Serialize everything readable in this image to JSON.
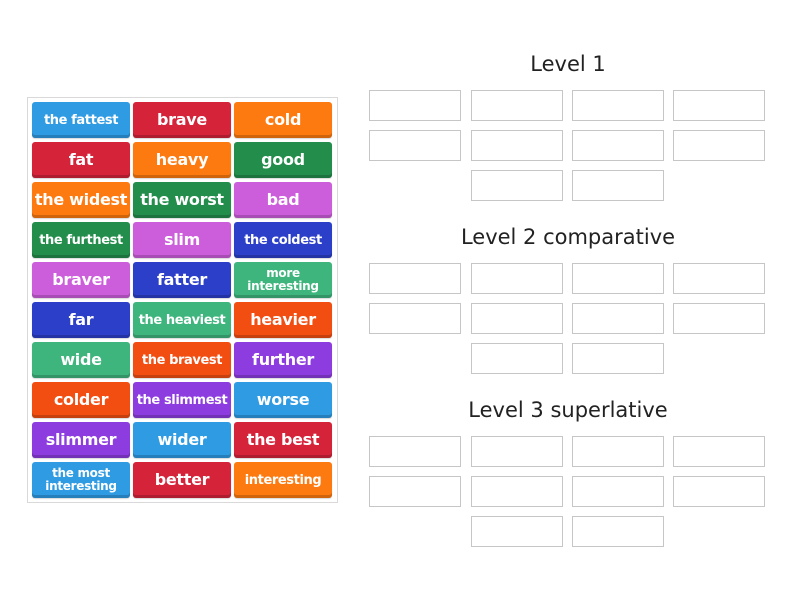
{
  "colors": {
    "blue": "#2f9be3",
    "red": "#d5233a",
    "orange": "#fd7a10",
    "green": "#238d4b",
    "pink": "#cd5edb",
    "navy": "#2b3fc9",
    "teal": "#3fb57e",
    "vermilion": "#f24e12",
    "purple": "#8d3ce0"
  },
  "tiles": [
    {
      "label": "the fattest",
      "color": "blue"
    },
    {
      "label": "brave",
      "color": "red"
    },
    {
      "label": "cold",
      "color": "orange"
    },
    {
      "label": "fat",
      "color": "red"
    },
    {
      "label": "heavy",
      "color": "orange"
    },
    {
      "label": "good",
      "color": "green"
    },
    {
      "label": "the widest",
      "color": "orange"
    },
    {
      "label": "the worst",
      "color": "green"
    },
    {
      "label": "bad",
      "color": "pink"
    },
    {
      "label": "the furthest",
      "color": "green"
    },
    {
      "label": "slim",
      "color": "pink"
    },
    {
      "label": "the coldest",
      "color": "navy"
    },
    {
      "label": "braver",
      "color": "pink"
    },
    {
      "label": "fatter",
      "color": "navy"
    },
    {
      "label": "more interesting",
      "color": "teal"
    },
    {
      "label": "far",
      "color": "navy"
    },
    {
      "label": "the heaviest",
      "color": "teal"
    },
    {
      "label": "heavier",
      "color": "vermilion"
    },
    {
      "label": "wide",
      "color": "teal"
    },
    {
      "label": "the bravest",
      "color": "vermilion"
    },
    {
      "label": "further",
      "color": "purple"
    },
    {
      "label": "colder",
      "color": "vermilion"
    },
    {
      "label": "the slimmest",
      "color": "purple"
    },
    {
      "label": "worse",
      "color": "blue"
    },
    {
      "label": "slimmer",
      "color": "purple"
    },
    {
      "label": "wider",
      "color": "blue"
    },
    {
      "label": "the best",
      "color": "red"
    },
    {
      "label": "the most interesting",
      "color": "blue"
    },
    {
      "label": "better",
      "color": "red"
    },
    {
      "label": "interesting",
      "color": "orange"
    }
  ],
  "groups": [
    {
      "title": "Level 1",
      "slots": 10
    },
    {
      "title": "Level 2 comparative",
      "slots": 10
    },
    {
      "title": "Level 3 superlative",
      "slots": 10
    }
  ]
}
